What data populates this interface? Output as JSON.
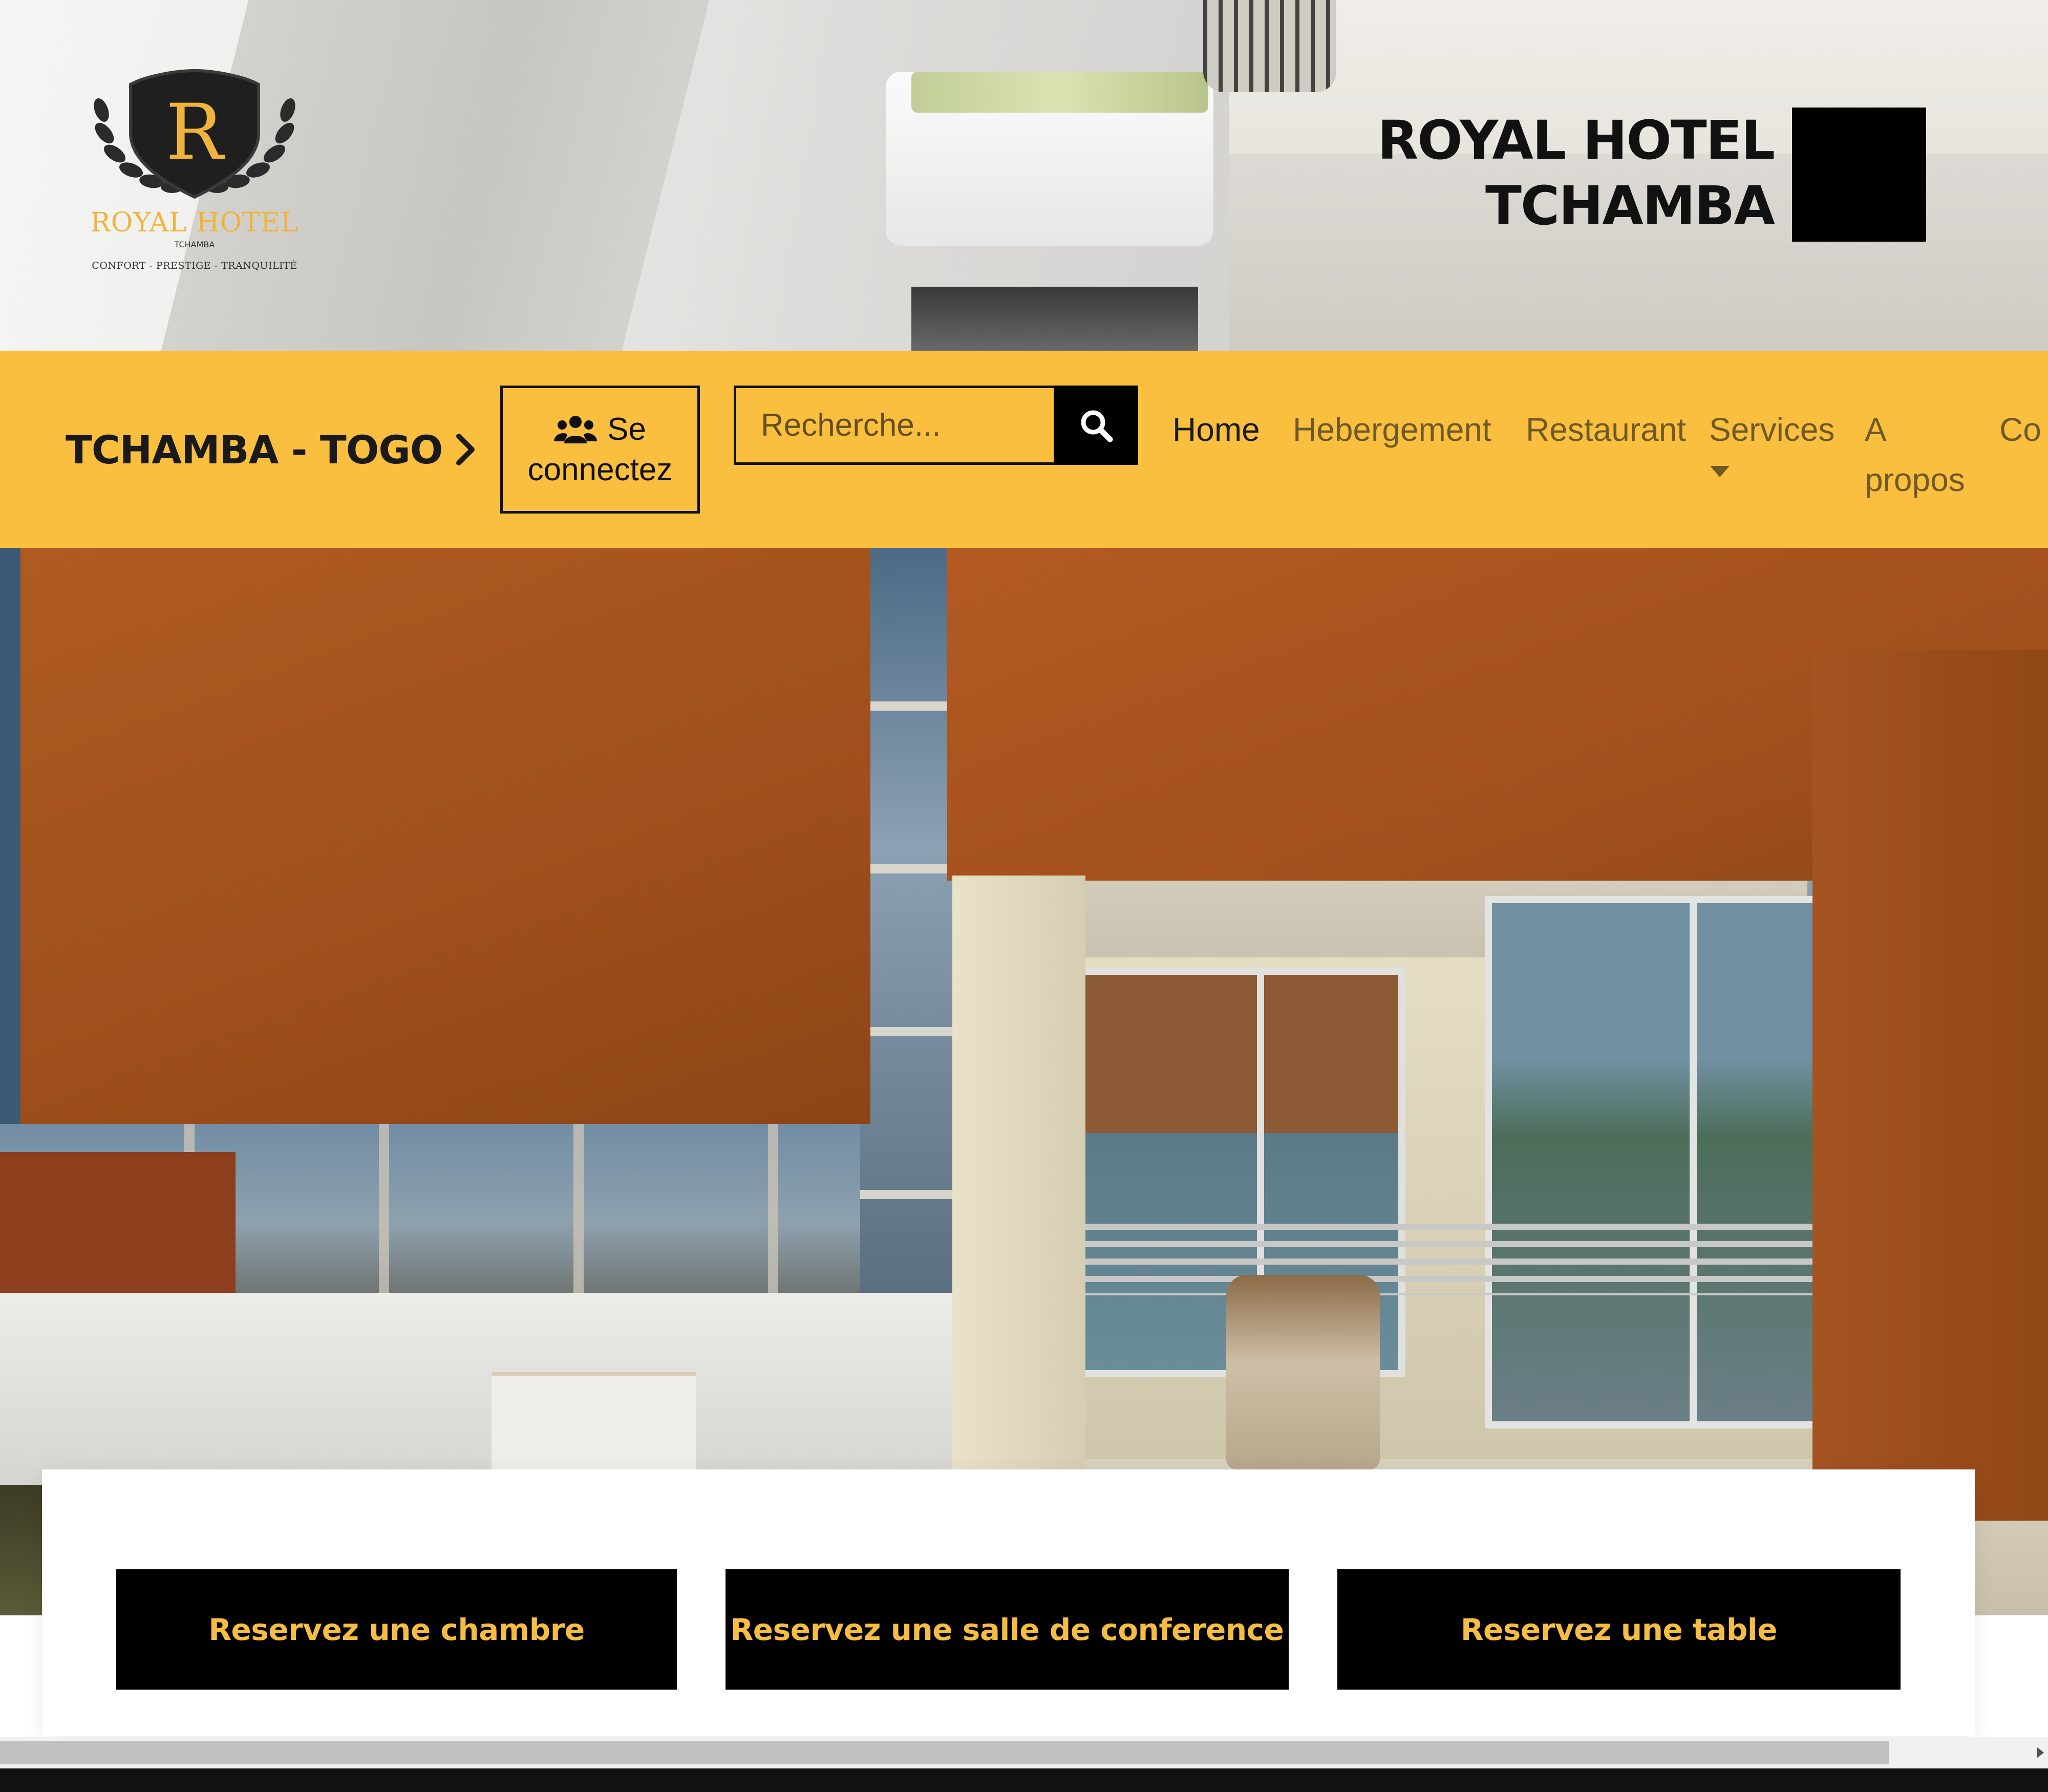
{
  "header": {
    "logo": {
      "letter": "R",
      "name": "ROYAL HOTEL",
      "sub": "TCHAMBA",
      "tagline": "CONFORT - PRESTIGE - TRANQUILITÉ"
    },
    "title_line1": "ROYAL HOTEL",
    "title_line2": "TCHAMBA"
  },
  "navbar": {
    "location": "TCHAMBA - TOGO",
    "login_line1": "Se",
    "login_line2": "connectez",
    "search_placeholder": "Recherche...",
    "menu": {
      "home": "Home",
      "hebergement": "Hebergement",
      "restaurant": "Restaurant",
      "services": "Services",
      "apropos": "A propos",
      "contact": "Co"
    }
  },
  "booking": {
    "room": "Reservez une chambre",
    "conference": "Reservez une salle de conference",
    "table": "Reservez une table"
  },
  "colors": {
    "brand_yellow": "#fbbf40",
    "button_black": "#000000",
    "button_text": "#f6bd42"
  },
  "icons": [
    "shield-logo-icon",
    "laurel-icon",
    "chevron-right-icon",
    "users-icon",
    "search-icon",
    "caret-down-icon",
    "scroll-right-icon"
  ]
}
